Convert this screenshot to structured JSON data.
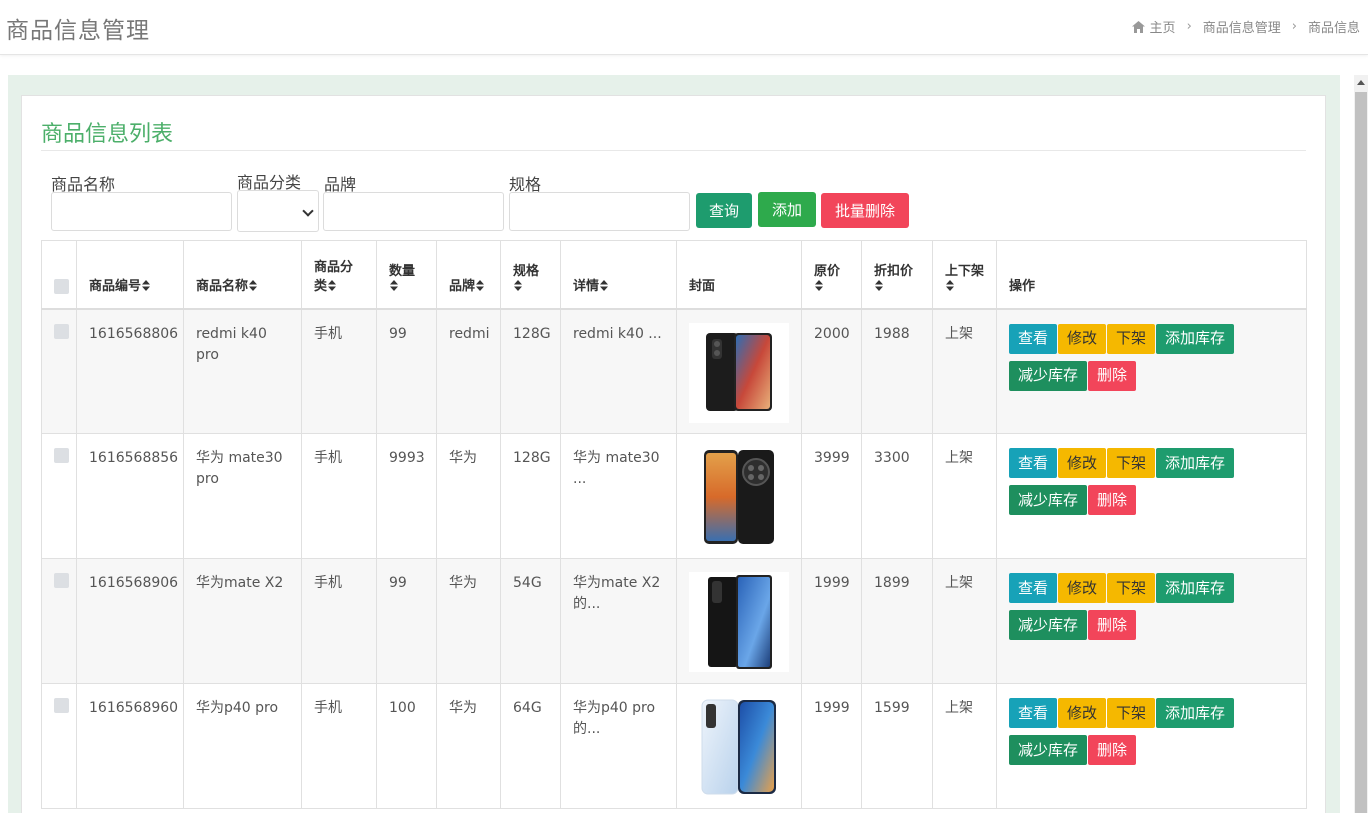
{
  "header": {
    "title": "商品信息管理",
    "breadcrumb": [
      "主页",
      "商品信息管理",
      "商品信息"
    ]
  },
  "card": {
    "title": "商品信息列表"
  },
  "filters": {
    "name_label": "商品名称",
    "category_label": "商品分类",
    "brand_label": "品牌",
    "spec_label": "规格",
    "name_value": "",
    "brand_value": "",
    "spec_value": ""
  },
  "buttons": {
    "query": "查询",
    "add": "添加",
    "batch_delete": "批量删除"
  },
  "table": {
    "headers": [
      "商品编号",
      "商品名称",
      "商品分类",
      "数量",
      "品牌",
      "规格",
      "详情",
      "封面",
      "原价",
      "折扣价",
      "上下架",
      "操作"
    ],
    "rows": [
      {
        "id": "1616568806",
        "name": "redmi k40 pro",
        "category": "手机",
        "qty": "99",
        "brand": "redmi",
        "spec": "128G",
        "detail": "redmi k40 ...",
        "price": "2000",
        "discount": "1988",
        "status": "上架"
      },
      {
        "id": "1616568856",
        "name": "华为 mate30 pro",
        "category": "手机",
        "qty": "9993",
        "brand": "华为",
        "spec": "128G",
        "detail": "华为 mate30 ...",
        "price": "3999",
        "discount": "3300",
        "status": "上架"
      },
      {
        "id": "1616568906",
        "name": "华为mate X2",
        "category": "手机",
        "qty": "99",
        "brand": "华为",
        "spec": "54G",
        "detail": "华为mate X2的...",
        "price": "1999",
        "discount": "1899",
        "status": "上架"
      },
      {
        "id": "1616568960",
        "name": "华为p40 pro",
        "category": "手机",
        "qty": "100",
        "brand": "华为",
        "spec": "64G",
        "detail": "华为p40 pro的...",
        "price": "1999",
        "discount": "1599",
        "status": "上架"
      }
    ],
    "actions": {
      "view": "查看",
      "edit": "修改",
      "off_shelf": "下架",
      "add_stock": "添加库存",
      "reduce_stock": "减少库存",
      "delete": "删除"
    }
  },
  "colors": {
    "accent_green": "#4caf6a",
    "query_button": "#1e9c6e",
    "add_button": "#2eaa4c",
    "delete_button": "#f2455a",
    "view_button": "#17a2b8",
    "warning_button": "#f5b800"
  },
  "icons": {
    "home": "home-icon",
    "sort": "sort-icon",
    "breadcrumb_separator": "chevron-right-icon"
  }
}
